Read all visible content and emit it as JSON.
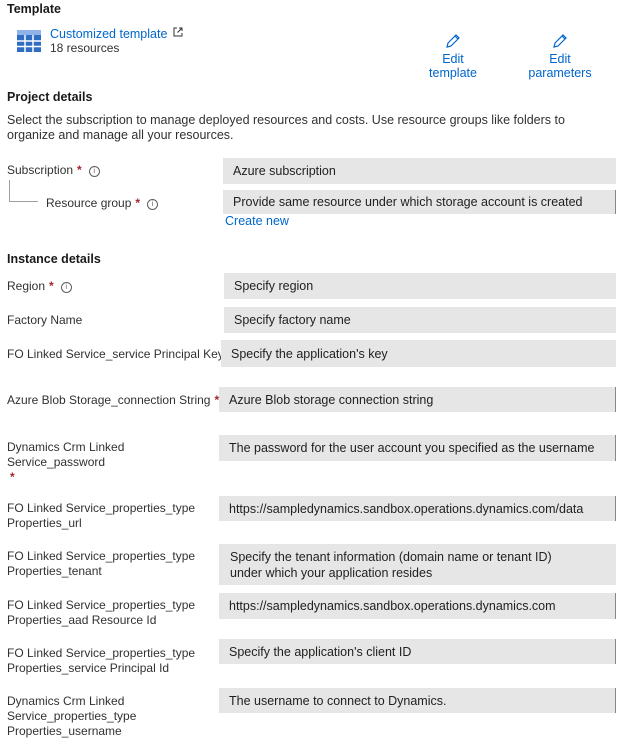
{
  "template": {
    "heading": "Template",
    "name": "Customized template",
    "resources": "18 resources",
    "edit_template": "Edit template",
    "edit_parameters": "Edit parameters"
  },
  "project": {
    "heading": "Project details",
    "description": "Select the subscription to manage deployed resources and costs. Use resource groups like folders to organize and manage all your resources.",
    "subscription_label": "Subscription",
    "subscription_value": "Azure subscription",
    "resource_group_label": "Resource group",
    "resource_group_value": "Provide same resource under which storage account is created",
    "create_new": "Create new"
  },
  "instance": {
    "heading": "Instance details",
    "fields": [
      {
        "label": "Region",
        "value": "Specify region"
      },
      {
        "label": "Factory Name",
        "value": "Specify factory name"
      },
      {
        "label": "FO Linked Service_service Principal Key",
        "value": "Specify the application's key"
      },
      {
        "label": "Azure Blob Storage_connection String",
        "value": "Azure Blob storage connection string"
      },
      {
        "label": "Dynamics Crm Linked Service_password",
        "value": "The password for the user account you specified as the username"
      },
      {
        "label": "FO Linked Service_properties_type Properties_url",
        "value": "https://sampledynamics.sandbox.operations.dynamics.com/data"
      },
      {
        "label": "FO Linked Service_properties_type Properties_tenant",
        "value": "Specify the tenant information (domain name or tenant ID) under which your application resides"
      },
      {
        "label": "FO Linked Service_properties_type Properties_aad Resource Id",
        "value": "https://sampledynamics.sandbox.operations.dynamics.com"
      },
      {
        "label": "FO Linked Service_properties_type Properties_service Principal Id",
        "value": "Specify the application's client ID"
      },
      {
        "label": "Dynamics Crm Linked Service_properties_type Properties_username",
        "value": "The username to connect to Dynamics."
      }
    ]
  },
  "colors": {
    "link": "#0066cc",
    "required": "#a4262c",
    "field_bg": "#e6e6e6",
    "template_icon": "#2f6dc3"
  }
}
